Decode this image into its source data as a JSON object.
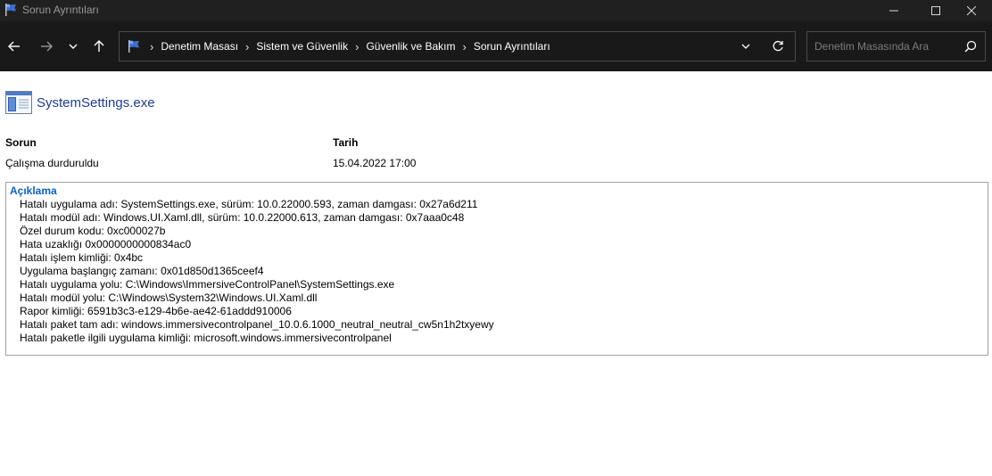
{
  "window": {
    "title": "Sorun Ayrıntıları"
  },
  "nav": {
    "back_icon": "arrow-left",
    "forward_icon": "arrow-right",
    "recent_icon": "chevron-down",
    "up_icon": "arrow-up"
  },
  "address": {
    "breadcrumbs": [
      "Denetim Masası",
      "Sistem ve Güvenlik",
      "Güvenlik ve Bakım",
      "Sorun Ayrıntıları"
    ]
  },
  "search": {
    "placeholder": "Denetim Masasında Ara"
  },
  "app": {
    "name": "SystemSettings.exe"
  },
  "details": {
    "problem_label": "Sorun",
    "problem_value": "Çalışma durduruldu",
    "date_label": "Tarih",
    "date_value": "15.04.2022 17:00"
  },
  "description": {
    "title": "Açıklama",
    "lines": [
      "Hatalı uygulama adı: SystemSettings.exe, sürüm: 10.0.22000.593, zaman damgası: 0x27a6d211",
      "Hatalı modül adı: Windows.UI.Xaml.dll, sürüm: 10.0.22000.613, zaman damgası: 0x7aaa0c48",
      "Özel durum kodu: 0xc000027b",
      "Hata uzaklığı 0x0000000000834ac0",
      "Hatalı işlem kimliği: 0x4bc",
      "Uygulama başlangıç zamanı: 0x01d850d1365ceef4",
      "Hatalı uygulama yolu: C:\\Windows\\ImmersiveControlPanel\\SystemSettings.exe",
      "Hatalı modül yolu: C:\\Windows\\System32\\Windows.UI.Xaml.dll",
      "Rapor kimliği: 6591b3c3-e129-4b6e-ae42-61addd910006",
      "Hatalı paket tam adı: windows.immersivecontrolpanel_10.0.6.1000_neutral_neutral_cw5n1h2txyewy",
      "Hatalı paketle ilgili uygulama kimliği: microsoft.windows.immersivecontrolpanel"
    ]
  },
  "colors": {
    "titlebar_bg": "#202020",
    "navbar_bg": "#191919",
    "link_blue": "#1e3c96",
    "section_blue": "#0b63c5"
  }
}
